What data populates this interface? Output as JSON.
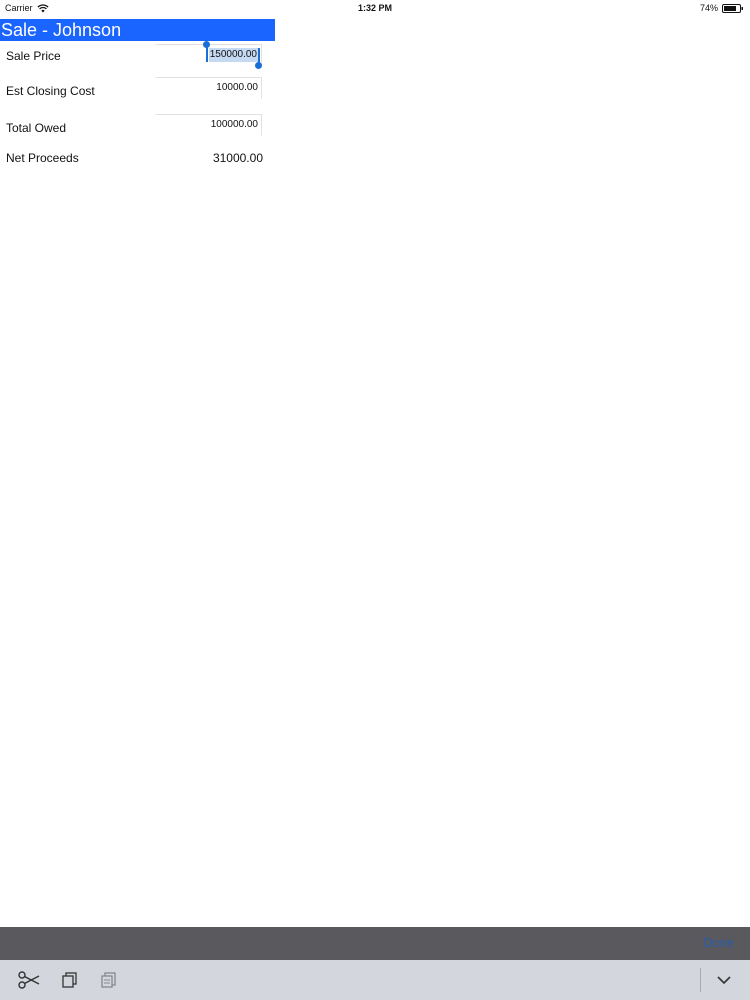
{
  "status_bar": {
    "carrier": "Carrier",
    "time": "1:32 PM",
    "battery": "74%"
  },
  "header": {
    "title": "Sale - Johnson"
  },
  "form": {
    "sale_price": {
      "label": "Sale Price",
      "value": "150000.00"
    },
    "closing_cost": {
      "label": "Est Closing Cost",
      "value": "10000.00"
    },
    "total_owed": {
      "label": "Total Owed",
      "value": "100000.00"
    },
    "net_proceeds": {
      "label": "Net Proceeds",
      "value": "31000.00"
    }
  },
  "keyboard": {
    "done_label": "Done",
    "shortcuts": [
      "scissors-icon",
      "copy-icon",
      "paste-icon",
      "chevron-down-icon"
    ]
  },
  "colors": {
    "title_bar": "#1a64ff",
    "selection": "#c6d9f3",
    "accessory_bar": "#5a595d",
    "shortcut_bar": "#d3d6dd"
  }
}
